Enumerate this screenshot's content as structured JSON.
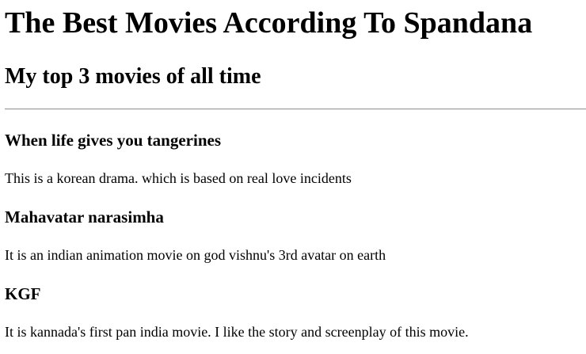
{
  "page": {
    "title": "The Best Movies According To Spandana",
    "subtitle": "My top 3 movies of all time"
  },
  "movies": [
    {
      "title": "When life gives you tangerines",
      "description": "This is a korean drama. which is based on real love incidents"
    },
    {
      "title": "Mahavatar narasimha",
      "description": "It is an indian animation movie on god vishnu's 3rd avatar on earth"
    },
    {
      "title": "KGF",
      "description": "It is kannada's first pan india movie. I like the story and screenplay of this movie."
    }
  ]
}
